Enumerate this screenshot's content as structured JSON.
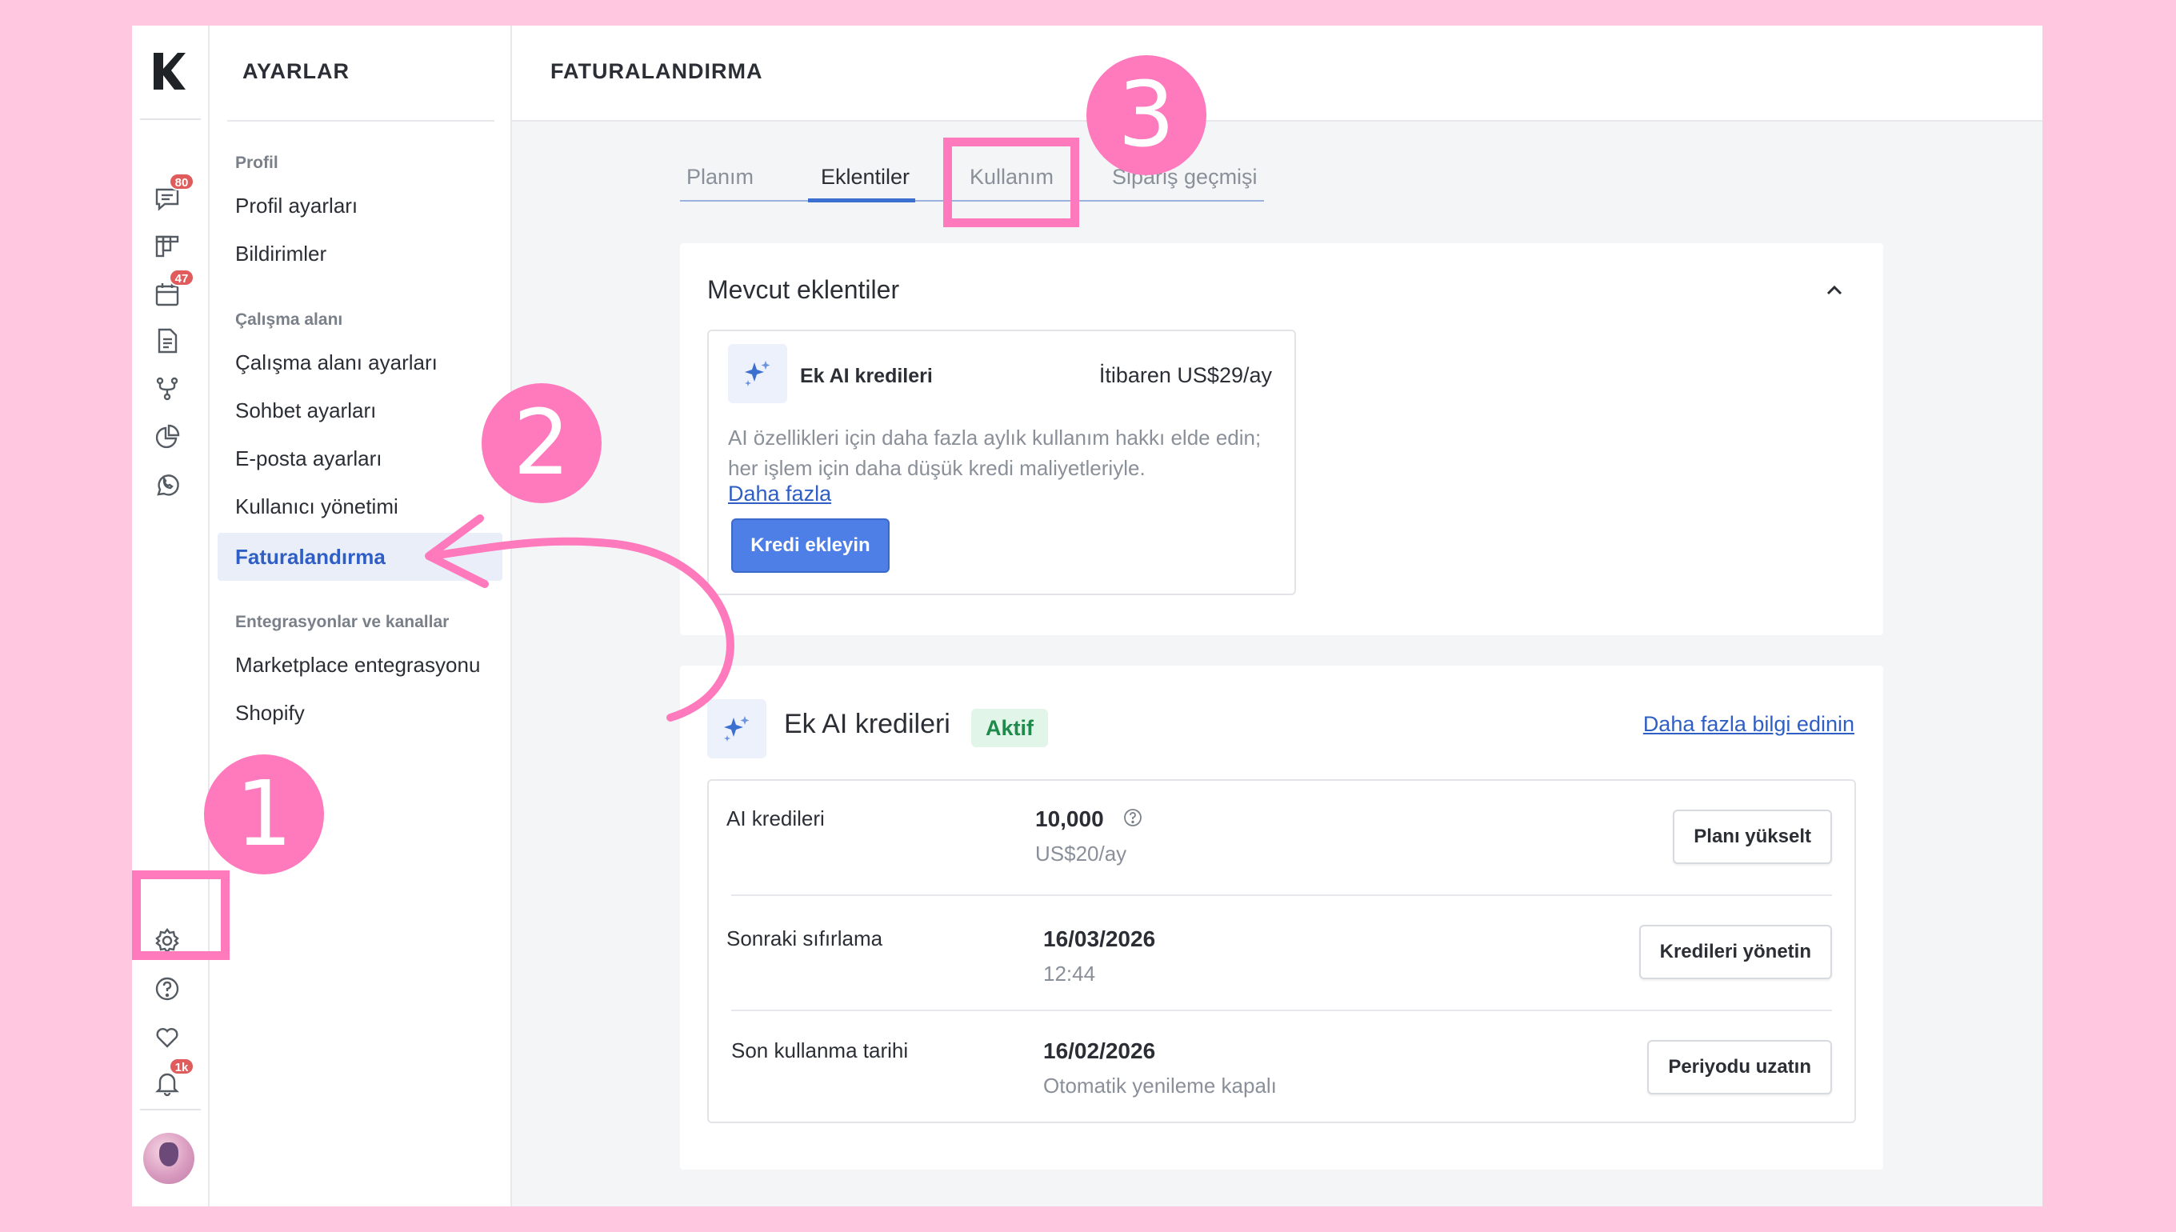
{
  "settings": {
    "title": "AYARLAR",
    "sections": [
      {
        "heading": "Profil",
        "items": [
          "Profil ayarları",
          "Bildirimler"
        ]
      },
      {
        "heading": "Çalışma alanı",
        "items": [
          "Çalışma alanı ayarları",
          "Sohbet ayarları",
          "E-posta ayarları",
          "Kullanıcı yönetimi",
          "Faturalandırma"
        ]
      },
      {
        "heading": "Entegrasyonlar ve kanallar",
        "items": [
          "Marketplace entegrasyonu",
          "Shopify"
        ]
      }
    ],
    "active_item": "Faturalandırma"
  },
  "rail": {
    "badges": {
      "chat": "80",
      "calendar": "47",
      "notifications": "1k"
    },
    "icons": [
      "chat-icon",
      "kanban-icon",
      "calendar-icon",
      "document-icon",
      "workflow-icon",
      "pie-chart-icon",
      "whatsapp-icon",
      "gear-icon",
      "help-icon",
      "heart-icon",
      "bell-icon"
    ]
  },
  "header": {
    "title": "FATURALANDIRMA"
  },
  "tabs": [
    "Planım",
    "Eklentiler",
    "Kullanım",
    "Sipariş geçmişi"
  ],
  "active_tab": "Eklentiler",
  "available_addons": {
    "title": "Mevcut eklentiler",
    "addon": {
      "name": "Ek AI kredileri",
      "price": "İtibaren US$29/ay",
      "description": "AI özellikleri için daha fazla aylık kullanım hakkı elde edin; her işlem için daha düşük kredi maliyetleriyle.",
      "link": "Daha fazla",
      "button": "Kredi ekleyin"
    }
  },
  "active_addon": {
    "title": "Ek AI kredileri",
    "status": "Aktif",
    "learn_more": "Daha fazla bilgi edinin",
    "rows": [
      {
        "label": "AI kredileri",
        "value": "10,000",
        "sub": "US$20/ay",
        "button": "Planı yükselt"
      },
      {
        "label": "Sonraki sıfırlama",
        "value": "16/03/2026",
        "sub": "12:44",
        "button": "Kredileri yönetin"
      },
      {
        "label": "Son kullanma tarihi",
        "value": "16/02/2026",
        "sub": "Otomatik yenileme kapalı",
        "button": "Periyodu uzatın"
      }
    ]
  },
  "annotations": {
    "step1": "1",
    "step2": "2",
    "step3": "3",
    "color": "#ff79bd"
  }
}
